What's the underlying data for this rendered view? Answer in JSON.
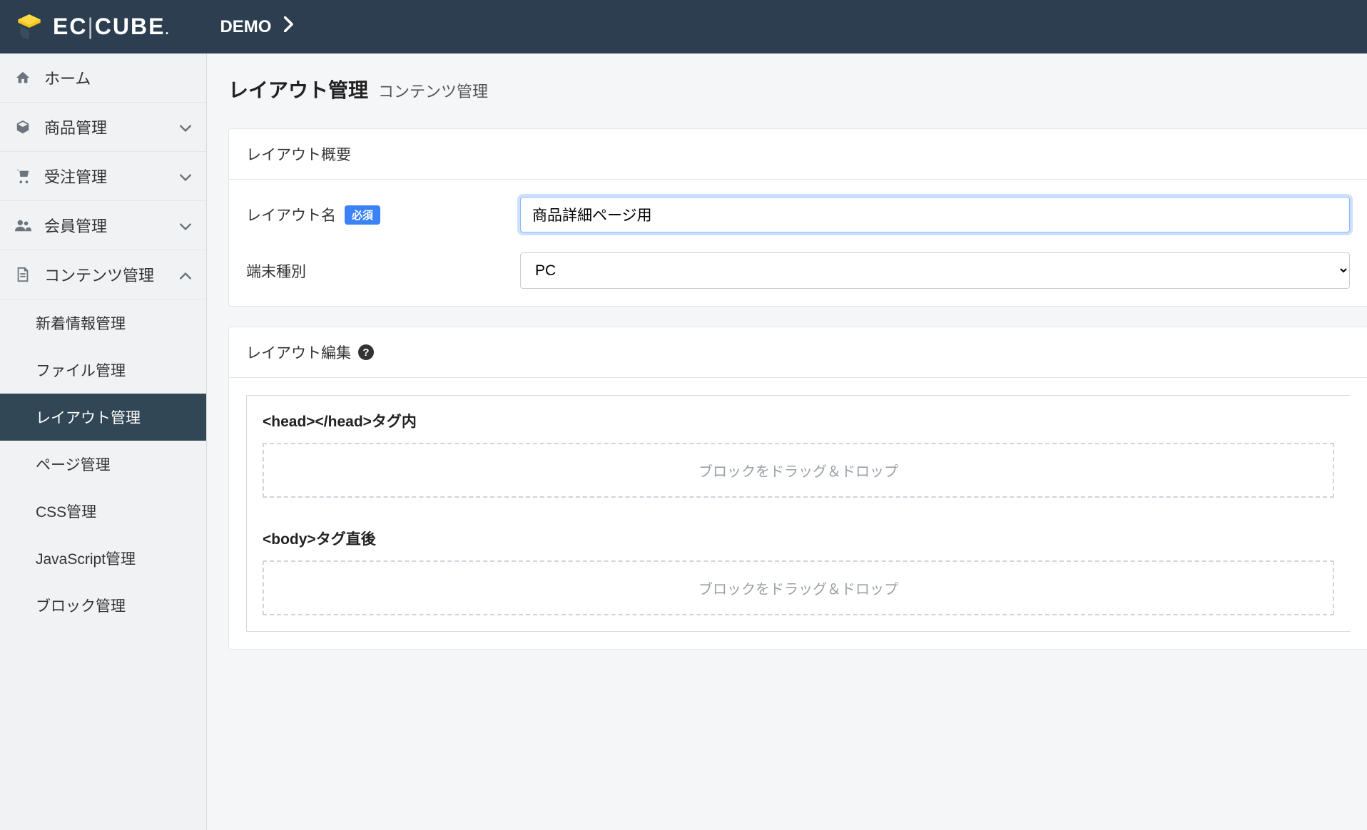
{
  "header": {
    "logo_text": "EC CUBE.",
    "breadcrumb": "DEMO"
  },
  "sidebar": {
    "items": [
      {
        "label": "ホーム",
        "icon": "home",
        "expandable": false
      },
      {
        "label": "商品管理",
        "icon": "cube",
        "expandable": true,
        "expanded": false
      },
      {
        "label": "受注管理",
        "icon": "cart",
        "expandable": true,
        "expanded": false
      },
      {
        "label": "会員管理",
        "icon": "users",
        "expandable": true,
        "expanded": false
      },
      {
        "label": "コンテンツ管理",
        "icon": "file",
        "expandable": true,
        "expanded": true,
        "children": [
          {
            "label": "新着情報管理",
            "active": false
          },
          {
            "label": "ファイル管理",
            "active": false
          },
          {
            "label": "レイアウト管理",
            "active": true
          },
          {
            "label": "ページ管理",
            "active": false
          },
          {
            "label": "CSS管理",
            "active": false
          },
          {
            "label": "JavaScript管理",
            "active": false
          },
          {
            "label": "ブロック管理",
            "active": false
          }
        ]
      }
    ]
  },
  "page": {
    "title": "レイアウト管理",
    "subtitle": "コンテンツ管理"
  },
  "overview": {
    "card_title": "レイアウト概要",
    "name_label": "レイアウト名",
    "required_text": "必須",
    "name_value": "商品詳細ページ用",
    "device_label": "端末種別",
    "device_value": "PC"
  },
  "editor": {
    "card_title": "レイアウト編集",
    "dropzone_text": "ブロックをドラッグ＆ドロップ",
    "regions": [
      {
        "label": "<head></head>タグ内"
      },
      {
        "label": "<body>タグ直後"
      }
    ]
  }
}
